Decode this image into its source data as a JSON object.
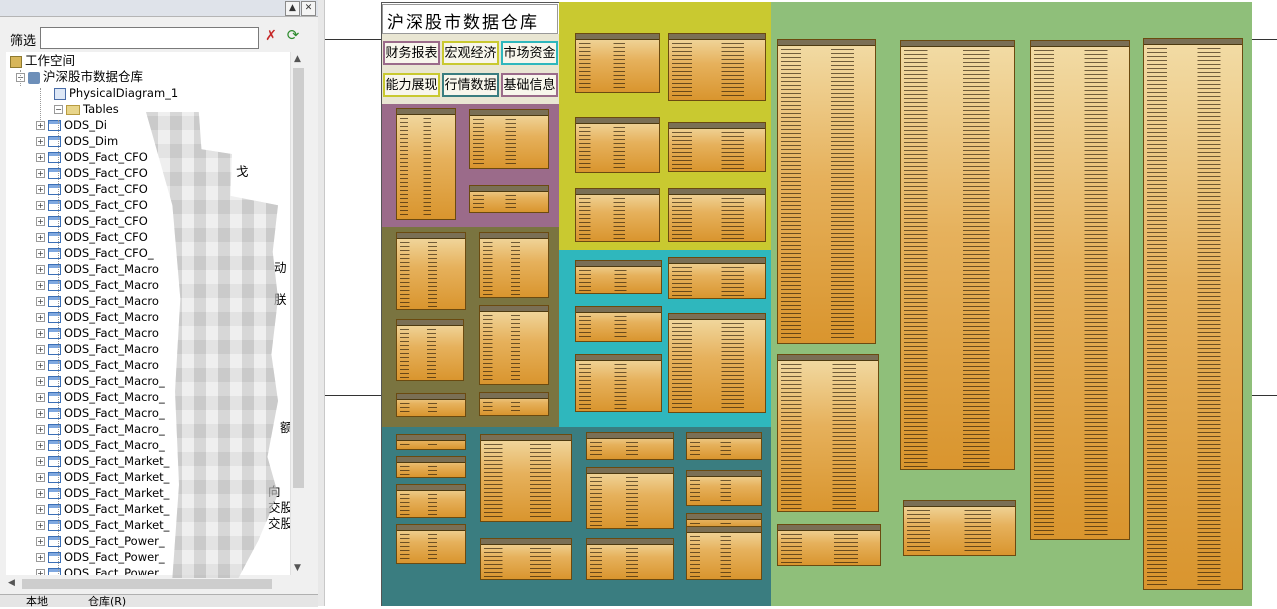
{
  "panel": {
    "filter_label": "筛选",
    "filter_value": "",
    "tree": [
      {
        "label": "工作空间",
        "icon": "workspace-icon",
        "level": 0
      },
      {
        "label": "沪深股市数据仓库",
        "icon": "database-model-icon",
        "level": 1
      },
      {
        "label": "PhysicalDiagram_1",
        "icon": "diagram-icon",
        "level": 2
      },
      {
        "label": "Tables",
        "icon": "folder-icon",
        "level": 2
      },
      {
        "label": "ODS_Di",
        "level": 3
      },
      {
        "label": "ODS_Dim",
        "level": 3
      },
      {
        "label": "ODS_Fact_CFO",
        "level": 3
      },
      {
        "label": "ODS_Fact_CFO",
        "level": 3
      },
      {
        "label": "ODS_Fact_CFO",
        "level": 3
      },
      {
        "label": "ODS_Fact_CFO",
        "level": 3
      },
      {
        "label": "ODS_Fact_CFO",
        "level": 3
      },
      {
        "label": "ODS_Fact_CFO",
        "level": 3
      },
      {
        "label": "ODS_Fact_CFO_",
        "level": 3
      },
      {
        "label": "ODS_Fact_Macro",
        "level": 3
      },
      {
        "label": "ODS_Fact_Macro",
        "level": 3
      },
      {
        "label": "ODS_Fact_Macro",
        "level": 3
      },
      {
        "label": "ODS_Fact_Macro",
        "level": 3
      },
      {
        "label": "ODS_Fact_Macro",
        "level": 3
      },
      {
        "label": "ODS_Fact_Macro",
        "level": 3
      },
      {
        "label": "ODS_Fact_Macro",
        "level": 3
      },
      {
        "label": "ODS_Fact_Macro_",
        "level": 3
      },
      {
        "label": "ODS_Fact_Macro_",
        "level": 3
      },
      {
        "label": "ODS_Fact_Macro_",
        "level": 3
      },
      {
        "label": "ODS_Fact_Macro_",
        "level": 3
      },
      {
        "label": "ODS_Fact_Macro_",
        "level": 3
      },
      {
        "label": "ODS_Fact_Market_",
        "level": 3
      },
      {
        "label": "ODS_Fact_Market_",
        "level": 3
      },
      {
        "label": "ODS_Fact_Market_",
        "level": 3
      },
      {
        "label": "ODS_Fact_Market_",
        "level": 3
      },
      {
        "label": "ODS_Fact_Market_",
        "level": 3
      },
      {
        "label": "ODS_Fact_Power_",
        "level": 3
      },
      {
        "label": "ODS_Fact_Power_",
        "level": 3
      },
      {
        "label": "ODS_Fact_Power",
        "level": 3
      }
    ],
    "trailing_fragments": [
      "戈",
      "动",
      "朕",
      "额",
      "向",
      "交股",
      "交股"
    ],
    "bottom_tabs": [
      "本地",
      "仓库(R)"
    ]
  },
  "diagram": {
    "title": "沪深股市数据仓库",
    "categories": [
      "财务报表",
      "宏观经济",
      "市场资金",
      "能力展现",
      "行情数据",
      "基础信息"
    ],
    "colors": {
      "purple": "#9b6b8a",
      "olive": "#7a7440",
      "yellow": "#c9c930",
      "cyan": "#2fb7bd",
      "teal": "#3a7d80",
      "green": "#8fbf7a"
    }
  }
}
